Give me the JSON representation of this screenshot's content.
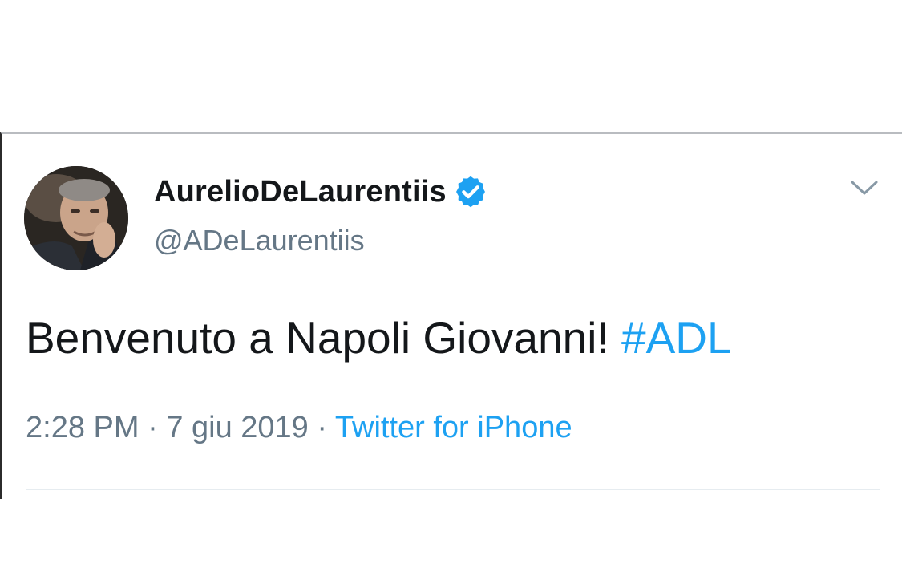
{
  "tweet": {
    "display_name": "AurelioDeLaurentiis",
    "handle": "@ADeLaurentiis",
    "verified_icon": "verified-badge-icon",
    "menu_icon": "chevron-down-icon",
    "text": "Benvenuto a Napoli Giovanni! ",
    "hashtag": "#ADL",
    "time": "2:28 PM",
    "separator": " · ",
    "date": "7 giu 2019",
    "source": "Twitter for iPhone"
  },
  "colors": {
    "link": "#1da1f2",
    "text": "#14171a",
    "secondary": "#657786",
    "verified": "#1da1f2"
  }
}
